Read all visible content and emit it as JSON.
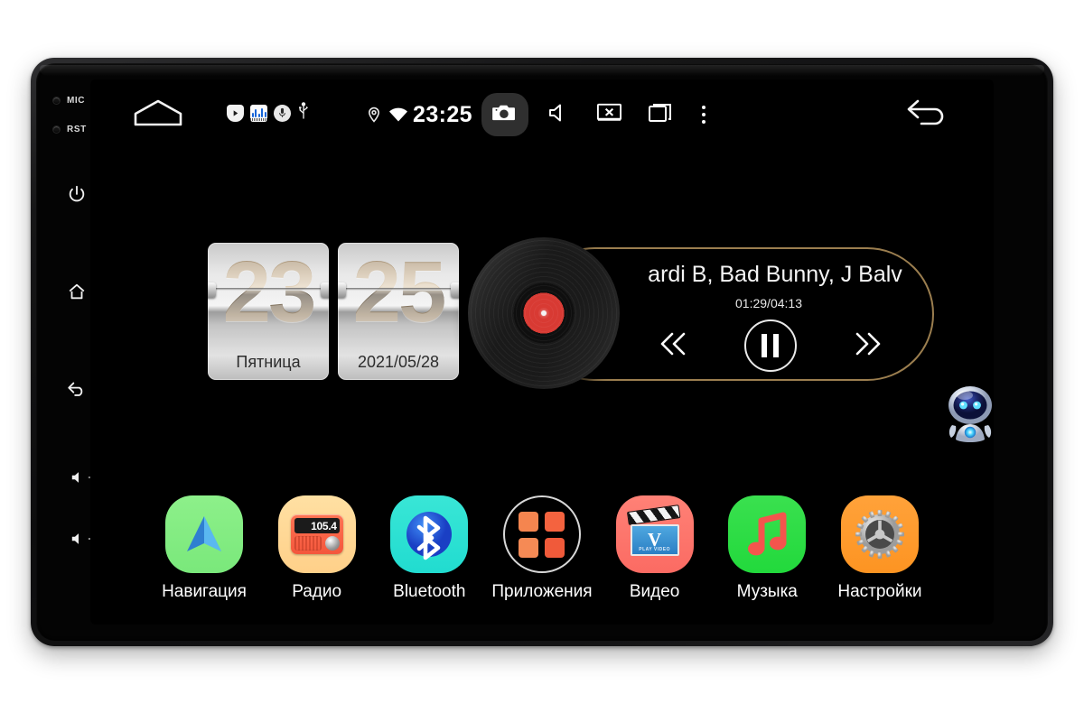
{
  "device": {
    "type": "android-car-head-unit",
    "bezel_pins": [
      {
        "name": "MIC",
        "label": "MIC"
      },
      {
        "name": "RST",
        "label": "RST"
      }
    ],
    "bezel_buttons": [
      {
        "name": "power",
        "icon": "power-icon",
        "label": ""
      },
      {
        "name": "home",
        "icon": "home-icon",
        "label": ""
      },
      {
        "name": "back",
        "icon": "back-arrow-icon",
        "label": ""
      },
      {
        "name": "volume-up",
        "icon": "speaker-icon",
        "label": "+"
      },
      {
        "name": "volume-down",
        "icon": "speaker-icon",
        "label": "−"
      }
    ]
  },
  "statusbar": {
    "home_tent_icon": "tent-home-icon",
    "notifications": [
      {
        "name": "play-shield-icon"
      },
      {
        "name": "audio-waveform-icon"
      },
      {
        "name": "microphone-icon"
      },
      {
        "name": "usb-icon"
      }
    ],
    "location_icon": "location-pin-icon",
    "wifi_icon": "wifi-icon",
    "clock": "23:25",
    "camera_icon": "camera-icon",
    "camera_active": true,
    "speaker_icon": "speaker-mute-icon",
    "screen_off_icon": "screen-off-icon",
    "recents_icon": "recent-apps-icon",
    "overflow_icon": "overflow-menu-icon",
    "back_icon": "back-arrow-icon"
  },
  "clock_widget": {
    "hours": "23",
    "minutes": "25",
    "weekday": "Пятница",
    "date": "2021/05/28"
  },
  "media": {
    "album_art": "vinyl-record-icon",
    "track_title": "ardi B, Bad Bunny, J Balv",
    "time": "01:29/04:13",
    "prev_icon": "previous-track-icon",
    "play_state_icon": "pause-icon",
    "next_icon": "next-track-icon",
    "ring_color": "#9b7e4f"
  },
  "assistant": {
    "name": "robot-assistant-icon",
    "visor_color": "#1b2566",
    "eye_color": "#4fd8ff"
  },
  "dock": {
    "apps": [
      {
        "name": "navigation",
        "label": "Навигация",
        "icon": "navigation-arrow-icon",
        "bg": "#7ee87b"
      },
      {
        "name": "radio",
        "label": "Радио",
        "icon": "radio-icon",
        "bg": "#ffd089",
        "display": "105.4"
      },
      {
        "name": "bluetooth",
        "label": "Bluetooth",
        "icon": "bluetooth-icon",
        "bg": "#21dcd0"
      },
      {
        "name": "apps",
        "label": "Приложения",
        "icon": "app-grid-icon",
        "bg": "transparent"
      },
      {
        "name": "video",
        "label": "Видео",
        "icon": "clapperboard-icon",
        "bg": "#fb6b63",
        "letter": "V"
      },
      {
        "name": "music",
        "label": "Музыка",
        "icon": "music-note-icon",
        "bg": "#22d93c"
      },
      {
        "name": "settings",
        "label": "Настройки",
        "icon": "gear-icon",
        "bg": "#fd9422"
      }
    ]
  }
}
